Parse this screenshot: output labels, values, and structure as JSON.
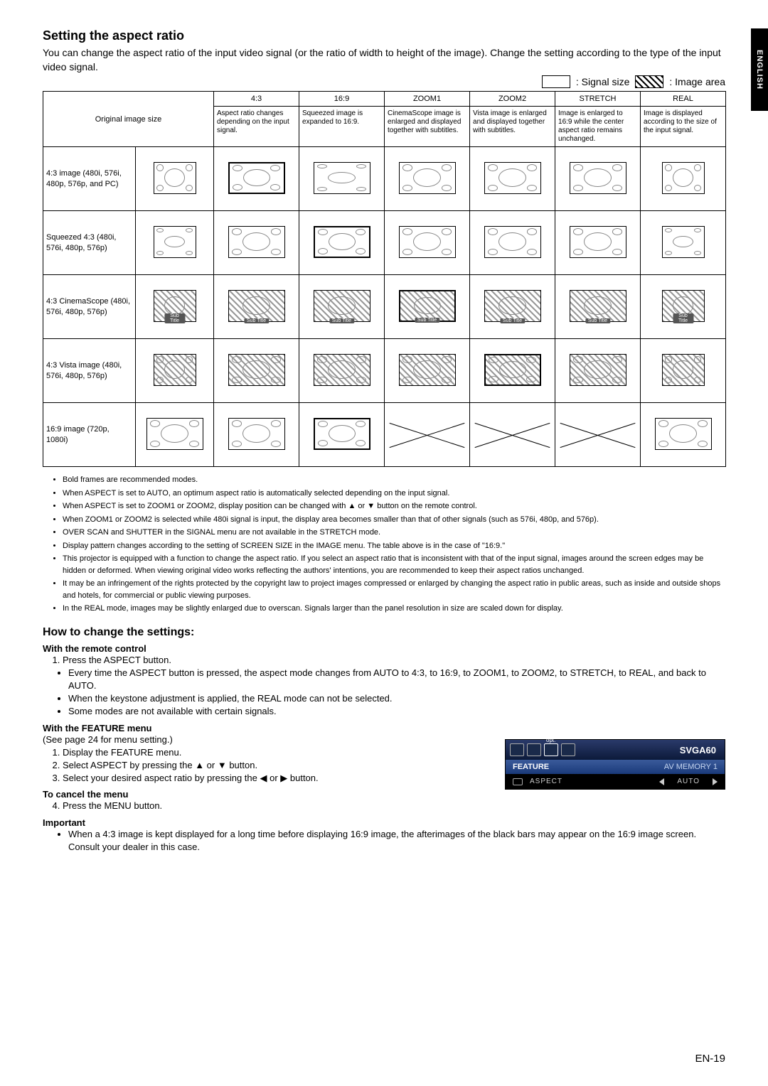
{
  "lang": "ENGLISH",
  "title": "Setting the aspect ratio",
  "intro": "You can change the aspect ratio of the input video signal (or the ratio of width to height of the image). Change the setting according to the type of the input video signal.",
  "legend": {
    "signal": ": Signal size",
    "image": ": Image area"
  },
  "table": {
    "h0": "Original image size",
    "cols": [
      "4:3",
      "16:9",
      "ZOOM1",
      "ZOOM2",
      "STRETCH",
      "REAL"
    ],
    "desc": [
      "Aspect ratio changes depending on the input signal.",
      "Squeezed image is expanded to 16:9.",
      "CinemaScope image is enlarged and displayed together with subtitles.",
      "Vista image is enlarged and displayed together with subtitles.",
      "Image is enlarged to 16:9 while the center aspect ratio remains unchanged.",
      "Image is displayed according to the size of the input signal."
    ],
    "rows": [
      "4:3 image (480i, 576i, 480p, 576p, and PC)",
      "Squeezed 4:3 (480i, 576i, 480p, 576p)",
      "4:3 CinemaScope (480i, 576i, 480p, 576p)",
      "4:3 Vista image (480i, 576i, 480p, 576p)",
      "16:9 image (720p, 1080i)"
    ],
    "sub": "Sub Title"
  },
  "notes": [
    "Bold frames are recommended modes.",
    "When ASPECT is set to AUTO, an optimum aspect ratio is automatically selected depending on the input signal.",
    "When ASPECT is set to ZOOM1 or ZOOM2, display position can be changed with ▲ or ▼ button on the remote control.",
    "When ZOOM1 or ZOOM2 is selected while 480i signal is input, the display area becomes smaller than that of other signals (such as 576i, 480p, and 576p).",
    "OVER SCAN and SHUTTER in the SIGNAL menu are not available in the STRETCH mode.",
    "Display pattern changes according to the setting of SCREEN SIZE in the IMAGE menu. The table above is in the case of \"16:9.\"",
    "This projector is equipped with a function to change the aspect ratio. If you select an aspect ratio that is inconsistent with that of the input signal, images around the screen edges may be hidden or deformed. When viewing original video works reflecting the authors' intentions, you are recommended to keep their aspect ratios unchanged.",
    "It may be an infringement of the rights protected by the copyright law to project images compressed or enlarged by changing the aspect ratio in public areas, such as inside and outside shops and hotels, for commercial or public viewing purposes.",
    "In the REAL mode, images may be slightly enlarged due to overscan. Signals larger than the panel resolution in size are scaled down for display."
  ],
  "howto_title": "How to change the settings:",
  "remote_h": "With the remote control",
  "remote_1": "Press the ASPECT button.",
  "remote_b": [
    "Every time the ASPECT button is pressed, the aspect mode changes from AUTO to 4:3, to 16:9, to ZOOM1, to ZOOM2, to STRETCH, to REAL, and back to AUTO.",
    "When the keystone adjustment is applied, the REAL mode can not be selected.",
    "Some modes are not available with certain signals."
  ],
  "feature_h": "With the FEATURE menu",
  "feature_p": "(See page 24 for menu setting.)",
  "feature_ol": [
    "Display the FEATURE menu.",
    "Select ASPECT by pressing the ▲ or ▼ button.",
    "Select your desired aspect ratio by pressing the ◀ or ▶ button."
  ],
  "cancel_h": "To cancel the menu",
  "cancel_4": "Press the MENU button.",
  "important_h": "Important",
  "important_b": "When a 4:3 image is kept displayed for a long time before displaying 16:9 image, the afterimages of the black bars may appear on the 16:9 image screen. Consult your dealer in this case.",
  "menu": {
    "signal": "SVGA60",
    "feature": "FEATURE",
    "avmem": "AV MEMORY 1",
    "aspect": "ASPECT",
    "auto": "AUTO",
    "opt": "opt."
  },
  "page": "EN-19"
}
